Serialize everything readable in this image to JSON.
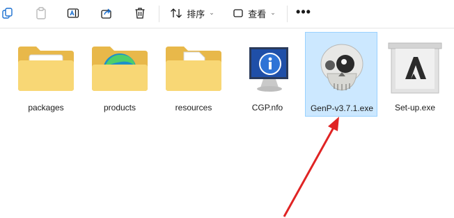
{
  "toolbar": {
    "sort_label": "排序",
    "view_label": "查看",
    "more_label": "•••",
    "caret": "⌄"
  },
  "files": [
    {
      "name": "packages",
      "type": "folder",
      "overlay": "package"
    },
    {
      "name": "products",
      "type": "folder",
      "overlay": "edge-logo"
    },
    {
      "name": "resources",
      "type": "folder",
      "overlay": "settings-file"
    },
    {
      "name": "CGP.nfo",
      "type": "info-file"
    },
    {
      "name": "GenP-v3.7.1.exe",
      "type": "skull-exe",
      "selected": true
    },
    {
      "name": "Set-up.exe",
      "type": "adobe-exe"
    }
  ],
  "colors": {
    "selection_bg": "#cce8ff",
    "selection_border": "#99d1ff",
    "folder_yellow": "#f8d775",
    "annotation_arrow": "#e02424"
  }
}
